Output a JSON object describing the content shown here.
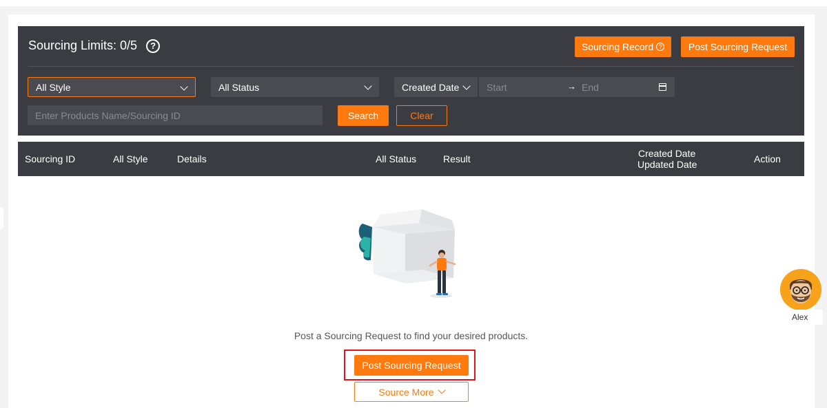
{
  "header": {
    "limits_label": "Sourcing Limits: 0/5",
    "help_icon": "?",
    "sourcing_record_label": "Sourcing Record",
    "record_help_icon": "?",
    "post_request_label": "Post Sourcing Request"
  },
  "filters": {
    "style_select": "All Style",
    "status_select": "All Status",
    "date_type_select": "Created Date",
    "start_placeholder": "Start",
    "date_arrow": "→",
    "end_placeholder": "End",
    "search_placeholder": "Enter Products Name/Sourcing ID",
    "search_label": "Search",
    "clear_label": "Clear"
  },
  "table": {
    "columns": {
      "sourcing_id": "Sourcing ID",
      "style": "All Style",
      "details": "Details",
      "status": "All Status",
      "result": "Result",
      "created_date": "Created Date",
      "updated_date": "Updated Date",
      "action": "Action"
    }
  },
  "empty_state": {
    "message": "Post a Sourcing Request to find your desired products.",
    "post_request_label": "Post Sourcing Request",
    "source_more_label": "Source More"
  },
  "assistant": {
    "name": "Alex"
  },
  "colors": {
    "accent": "#ff7a0e",
    "panel": "#3b3c41",
    "highlight": "#e0141e"
  }
}
